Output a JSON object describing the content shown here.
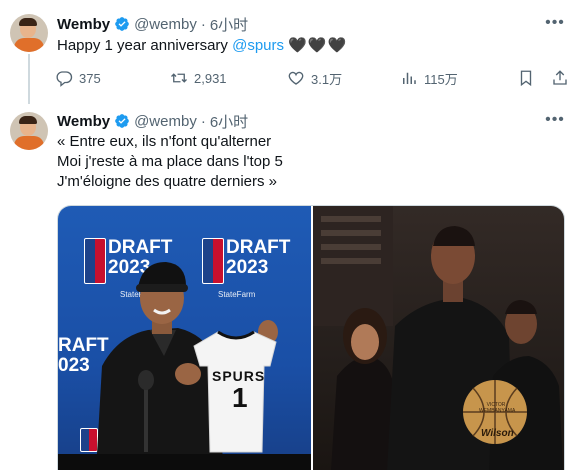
{
  "tweet1": {
    "author_name": "Wemby",
    "handle": "@wemby",
    "separator": "·",
    "time": "6小时",
    "text_before_mention": "Happy 1 year anniversary ",
    "mention": "@spurs",
    "hearts": "🖤🖤🖤",
    "actions": {
      "replies": "375",
      "retweets": "2,931",
      "likes": "3.1万",
      "views": "115万"
    }
  },
  "tweet2": {
    "author_name": "Wemby",
    "handle": "@wemby",
    "separator": "·",
    "time": "6小时",
    "lines": [
      "« Entre eux, ils n'font qu'alterner",
      "Moi j'reste à ma place dans l'top 5",
      "J'm'éloigne des quatre derniers »"
    ]
  },
  "media": {
    "left_photo": {
      "backdrop_text_1": "DRAFT",
      "backdrop_text_2": "2023",
      "sub_text": "StateFarm",
      "side_text_1": "RAFT",
      "side_text_2": "023",
      "jersey_text": "SPURS",
      "jersey_number": "1"
    },
    "right_photo": {
      "ball_brand": "Wilson",
      "ball_text": "VICTOR WEMBANYAMA"
    }
  },
  "colors": {
    "accent": "#1d9bf0",
    "secondary_text": "#536471",
    "verified": "#1d9bf0"
  },
  "icons": [
    "verified-badge-icon",
    "more-icon",
    "reply-icon",
    "retweet-icon",
    "like-icon",
    "views-icon",
    "bookmark-icon",
    "share-icon"
  ]
}
